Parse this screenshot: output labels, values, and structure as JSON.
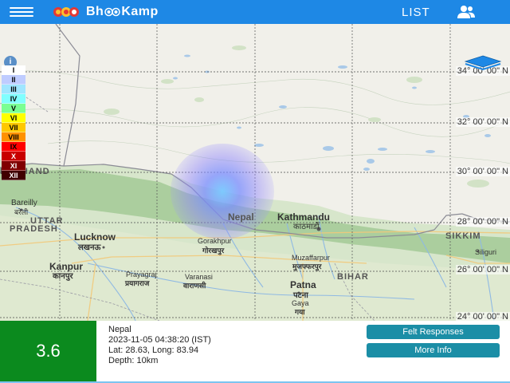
{
  "header": {
    "app_name_left": "Bh",
    "app_name_right": "Kamp",
    "list_label": "LIST",
    "menu_icon": "hamburger-menu-icon",
    "user_icon": "users-icon",
    "brand_color": "#1e88e5"
  },
  "map": {
    "latitude_labels": [
      "34° 00' 00\" N",
      "32° 00' 00\" N",
      "30° 00' 00\" N",
      "28° 00' 00\" N",
      "26° 00' 00\" N",
      "24° 00' 00\" N"
    ],
    "regions": {
      "uttarakhand": "RAKHAND",
      "uttar_pradesh_1": "UTTAR",
      "uttar_pradesh_2": "PRADESH",
      "bihar": "BIHAR",
      "sikkim": "SIKKIM"
    },
    "places": {
      "nepal": "Nepal",
      "kathmandu": "Kathmandu",
      "kathmandu_native": "काठमाडौं",
      "bareilly": "Bareilly",
      "bareilly_native": "बरेली",
      "lucknow": "Lucknow",
      "lucknow_native": "लखनऊ",
      "kanpur": "Kanpur",
      "kanpur_native": "कानपुर",
      "gorakhpur": "Gorakhpur",
      "gorakhpur_native": "गोरखपुर",
      "prayagraj": "Prayagraj",
      "prayagraj_native": "प्रयागराज",
      "varanasi": "Varanasi",
      "varanasi_native": "वाराणसी",
      "muzaffarpur": "Muzaffarpur",
      "muzaffarpur_native": "मुजफ्फरपुर",
      "patna": "Patna",
      "patna_native": "पटना",
      "gaya": "Gaya",
      "gaya_native": "गया",
      "siliguri": "Siliguri"
    },
    "intensity_legend": [
      {
        "label": "I",
        "color": "#ffffff"
      },
      {
        "label": "II",
        "color": "#bfccff"
      },
      {
        "label": "III",
        "color": "#a0e6ff"
      },
      {
        "label": "IV",
        "color": "#80ffff"
      },
      {
        "label": "V",
        "color": "#7aff93"
      },
      {
        "label": "VI",
        "color": "#ffff00"
      },
      {
        "label": "VII",
        "color": "#ffc800"
      },
      {
        "label": "VIII",
        "color": "#ff9100"
      },
      {
        "label": "IX",
        "color": "#ff0000"
      },
      {
        "label": "X",
        "color": "#c80000"
      },
      {
        "label": "XI",
        "color": "#800000"
      },
      {
        "label": "XII",
        "color": "#400000"
      }
    ],
    "info_icon": "info-icon",
    "layers_icon": "layers-icon"
  },
  "event": {
    "magnitude": "3.6",
    "magnitude_color": "#0b8a1e",
    "location": "Nepal",
    "datetime": "2023-11-05 04:38:20 (IST)",
    "coordinates": "Lat: 28.63, Long: 83.94",
    "depth": "Depth: 10km",
    "felt_button": "Felt Responses",
    "info_button": "More Info",
    "button_color": "#1b8ea6"
  }
}
